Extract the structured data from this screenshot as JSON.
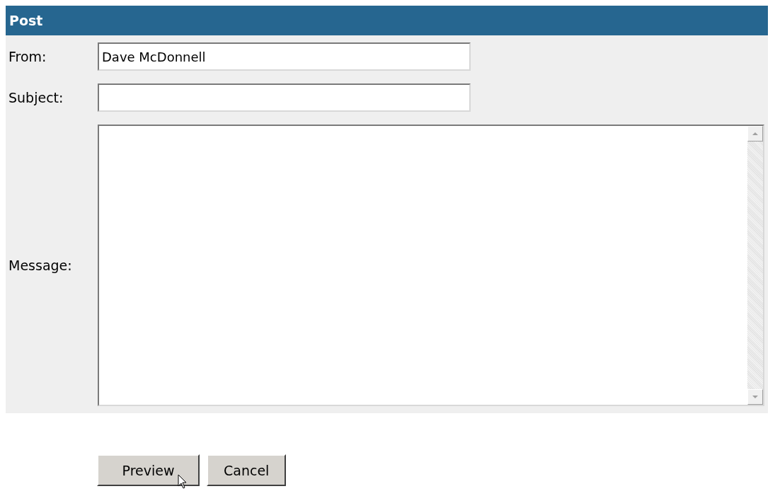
{
  "panel": {
    "title": "Post"
  },
  "fields": [
    {
      "kind": "input",
      "label": "From:",
      "value": "Dave McDonnell"
    },
    {
      "kind": "input",
      "label": "Subject:"
    },
    {
      "kind": "textarea",
      "label": "Message:"
    }
  ],
  "buttons": [
    "Preview",
    "Cancel"
  ]
}
